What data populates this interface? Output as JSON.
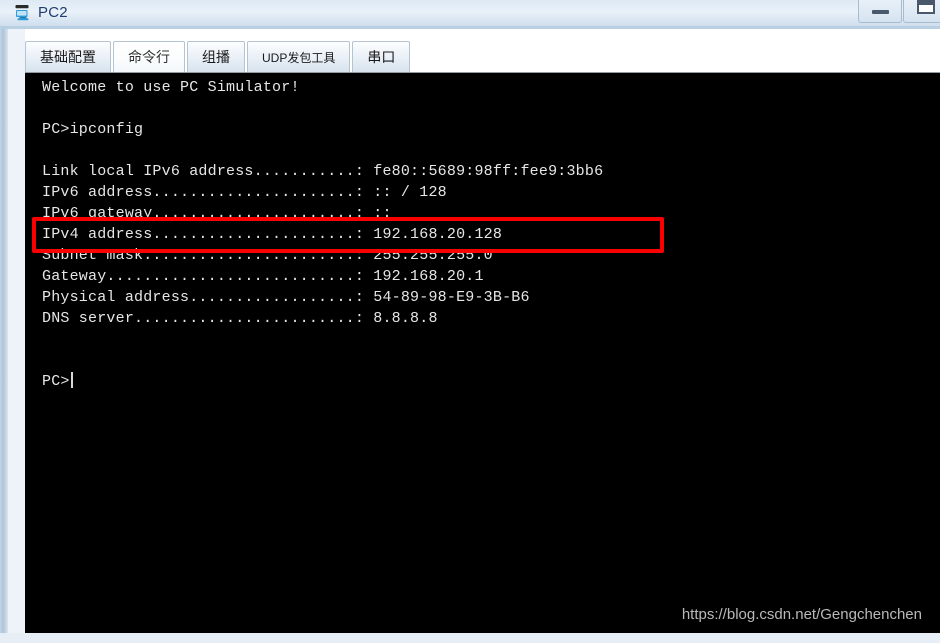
{
  "window": {
    "title": "PC2",
    "icon": "pc-monitor-icon",
    "controls": [
      {
        "name": "minimize-button",
        "glyph": "minimize"
      },
      {
        "name": "maximize-button",
        "glyph": "maximize"
      }
    ]
  },
  "tabs": [
    {
      "label": "基础配置",
      "active": false,
      "small": false
    },
    {
      "label": "命令行",
      "active": true,
      "small": false
    },
    {
      "label": "组播",
      "active": false,
      "small": false
    },
    {
      "label": "UDP发包工具",
      "active": false,
      "small": true
    },
    {
      "label": "串口",
      "active": false,
      "small": false
    }
  ],
  "terminal": {
    "lines": [
      "Welcome to use PC Simulator!",
      "",
      "PC>ipconfig",
      "",
      "Link local IPv6 address...........: fe80::5689:98ff:fee9:3bb6",
      "IPv6 address......................: :: / 128",
      "IPv6 gateway......................: ::",
      "IPv4 address......................: 192.168.20.128",
      "Subnet mask.......................: 255.255.255.0",
      "Gateway...........................: 192.168.20.1",
      "Physical address..................: 54-89-98-E9-3B-B6",
      "DNS server........................: 8.8.8.8",
      "",
      "",
      "PC>"
    ],
    "prompt": "PC>",
    "command": "ipconfig",
    "fields": {
      "link_local_ipv6_address": "fe80::5689:98ff:fee9:3bb6",
      "ipv6_address": ":: / 128",
      "ipv6_gateway": "::",
      "ipv4_address": "192.168.20.128",
      "subnet_mask": "255.255.255.0",
      "gateway": "192.168.20.1",
      "physical_address": "54-89-98-E9-3B-B6",
      "dns_server": "8.8.8.8"
    }
  },
  "annotation": {
    "highlight_target": "IPv4 address......................: 192.168.20.128",
    "color": "#fb0000"
  },
  "watermark": {
    "text": "https://blog.csdn.net/Gengchenchen"
  }
}
